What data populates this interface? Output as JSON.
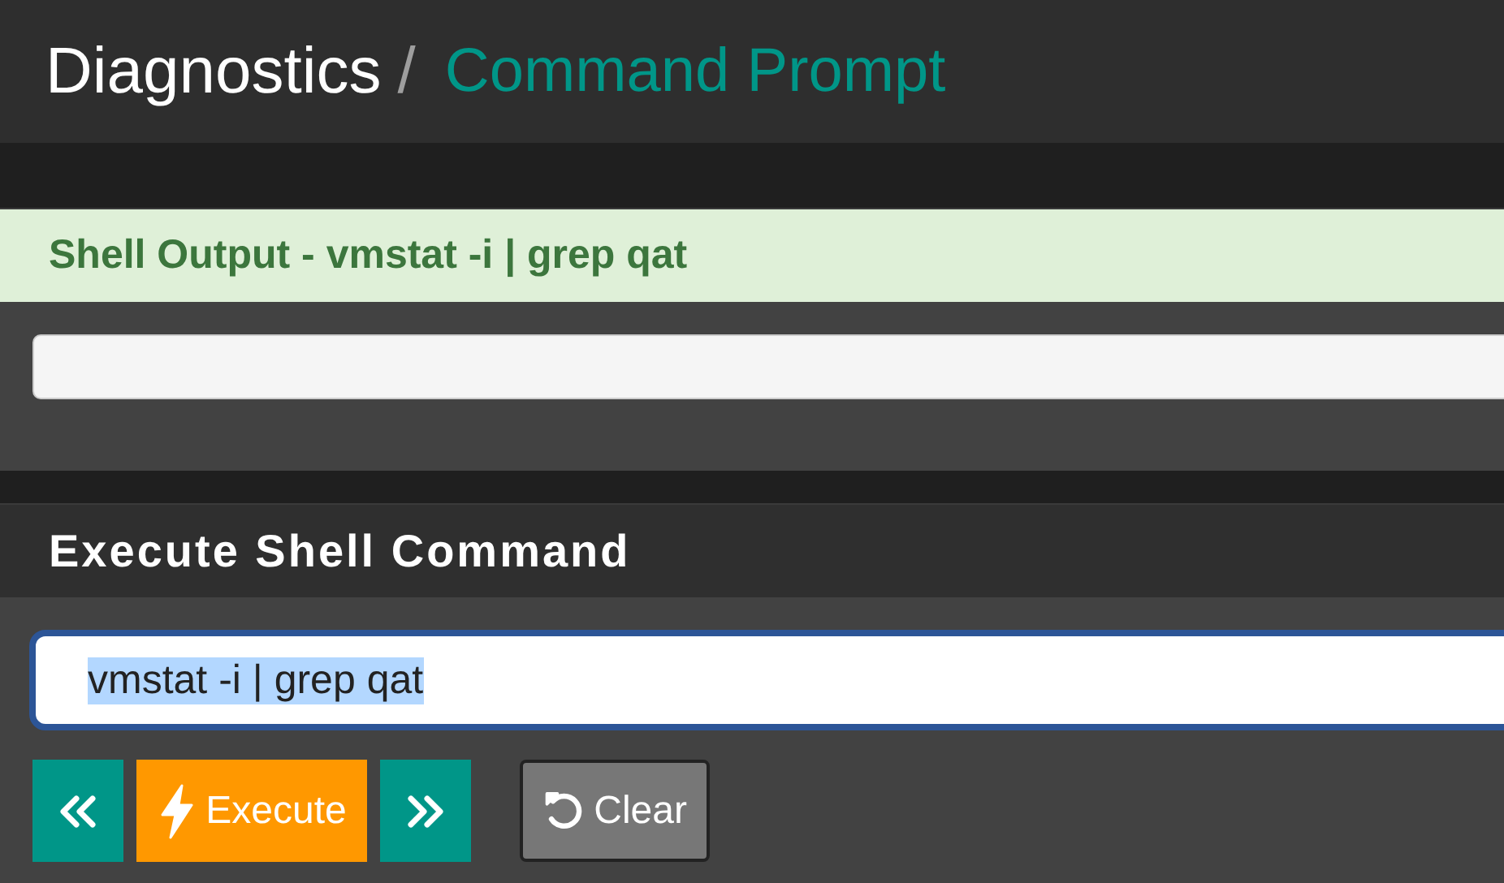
{
  "breadcrumb": {
    "parent": "Diagnostics",
    "separator": "/",
    "current": "Command Prompt"
  },
  "output_panel": {
    "title": "Shell Output - vmstat -i | grep qat"
  },
  "command_panel": {
    "title": "Execute Shell Command",
    "input": {
      "value": "vmstat -i | grep qat",
      "text_selected": true
    },
    "buttons": [
      {
        "kind": "prev"
      },
      {
        "kind": "execute",
        "label": "Execute"
      },
      {
        "kind": "next"
      },
      {
        "kind": "clear",
        "label": "Clear"
      }
    ]
  }
}
